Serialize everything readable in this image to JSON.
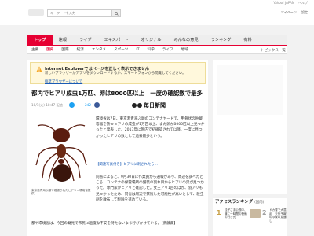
{
  "top_links": [
    "Yahoo! JAPAN",
    "ヘルプ"
  ],
  "search": {
    "placeholder": "キーワードを入力",
    "button_icon": "search-icon"
  },
  "header_right": [
    "マイページ",
    "設定"
  ],
  "nav_primary": [
    "トップ",
    "速報",
    "ライブ",
    "エキスパート",
    "オリジナル",
    "みんなの意見",
    "ランキング",
    "有料"
  ],
  "nav_secondary": [
    "主要",
    "国内",
    "国際",
    "経済",
    "エンタメ",
    "スポーツ",
    "IT",
    "科学",
    "ライフ",
    "地域"
  ],
  "nav_secondary_right": "トピックス一覧",
  "alert": {
    "title": "Internet Explorerではページを正しく表示できません",
    "body": "新しいブラウザーかアプリをダウンロードするか、スマートフォンから閲覧してください。",
    "link": "推奨ブラウザーについて"
  },
  "article": {
    "title": "都内でヒアリ成虫1万匹、卵は8000匹以上　一度の確認数で最多",
    "dateline": "10/1(火) 18:47 配信",
    "share_count": "242",
    "source": "毎日新聞",
    "caption": "東京港青海ふ頭で確認されたヒアリ＝環境省提供",
    "para1": "環境省は7日、東京港青海ふ頭のコンテナヤードで、甲骨状の貯蔵容器を持つヒアリの成虫が1万匹以上、また卵が8000匹以上見つかったと発表した。2017年に国内で初確認されて以降、一度に見つかったヒアリの数として過去最多という。",
    "related_link": "【関連写真付き】ヒアリに刺されたら…",
    "para2": "同省によると、9月30日に作業員から通報があり、周辺を調べたところ、コンテナの保管場所の舗装の割れ目からヒアリの巣が見つかった。専門家がヒアリと確認した。女王アリ1匹のほか、羽アリも見つかったため、同省は周辺で繁殖した可能性が高いとして、殺虫剤を散布して駆除を進めている。",
    "para3": "都や環境省は、今回の発見で市民に過度な不安を持たないよう呼びかけている。【斎藤繭】"
  },
  "ranking": {
    "title": "アクセスランキング",
    "subtitle": "(国内)",
    "items": [
      {
        "rank": "1",
        "text": "佳子さま公務中、道に一時間の警備の行き先"
      },
      {
        "rank": "2",
        "text": "ドカ雪で大混乱　天気予報の今後の見通し"
      }
    ]
  },
  "colors": {
    "accent": "#e60033",
    "alert_bg": "#fff8dc",
    "link": "#1a5bb5"
  }
}
